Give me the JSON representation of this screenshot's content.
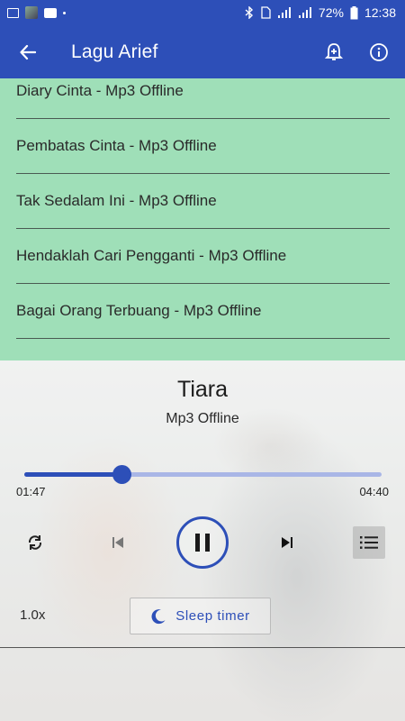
{
  "status_bar": {
    "battery": "72%",
    "time": "12:38"
  },
  "app_bar": {
    "title": "Lagu Arief",
    "back_icon": "arrow-back-icon",
    "alarm_icon": "alarm-add-icon",
    "info_icon": "info-icon"
  },
  "song_list": {
    "items": [
      {
        "title": "Diary Cinta - Mp3 Offline"
      },
      {
        "title": "Pembatas Cinta - Mp3 Offline"
      },
      {
        "title": "Tak Sedalam Ini - Mp3 Offline"
      },
      {
        "title": "Hendaklah Cari Pengganti - Mp3 Offline"
      },
      {
        "title": "Bagai Orang Terbuang - Mp3 Offline"
      }
    ]
  },
  "player": {
    "title": "Tiara",
    "subtitle": "Mp3 Offline",
    "current_time": "01:47",
    "total_time": "04:40",
    "progress": 0.273,
    "speed": "1.0x",
    "sleep_timer_label": "Sleep timer",
    "accent_color": "#2d4fb8"
  },
  "colors": {
    "primary": "#2d4fb8",
    "list_background": "#9fdfb8"
  }
}
